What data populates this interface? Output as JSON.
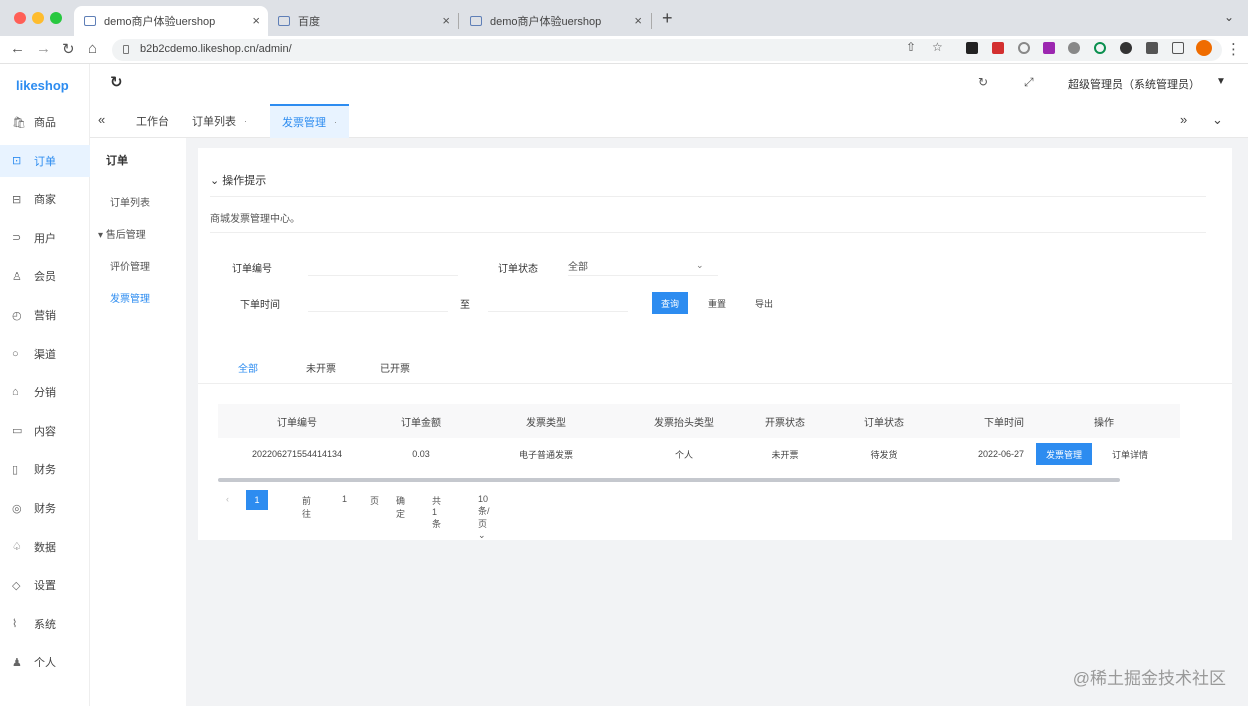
{
  "browser": {
    "tabs": [
      {
        "label": "demo商户体验uershop"
      },
      {
        "label": "百度"
      },
      {
        "label": "demo商户体验uershop"
      }
    ],
    "url": "b2b2cdemo.likeshop.cn/admin/"
  },
  "app": {
    "logo": "likeshop",
    "sidebar": [
      {
        "label": "商品",
        "icon": "🛍"
      },
      {
        "label": "订单",
        "icon": "⊡"
      },
      {
        "label": "商家",
        "icon": "⊟"
      },
      {
        "label": "用户",
        "icon": "⊃"
      },
      {
        "label": "会员",
        "icon": "♙"
      },
      {
        "label": "营销",
        "icon": "◴"
      },
      {
        "label": "渠道",
        "icon": "○"
      },
      {
        "label": "分销",
        "icon": "⌂"
      },
      {
        "label": "内容",
        "icon": "▭"
      },
      {
        "label": "财务",
        "icon": "▯"
      },
      {
        "label": "财务",
        "icon": "◎"
      },
      {
        "label": "数据",
        "icon": "♤"
      },
      {
        "label": "设置",
        "icon": "◇"
      },
      {
        "label": "系统",
        "icon": "⌇"
      },
      {
        "label": "个人",
        "icon": "♟"
      }
    ],
    "submenu": {
      "title": "订单",
      "items": [
        {
          "label": "订单列表"
        },
        {
          "label": "售后管理"
        },
        {
          "label": "评价管理"
        },
        {
          "label": "发票管理"
        }
      ]
    },
    "header": {
      "user": "超级管理员（系统管理员）"
    },
    "page_tabs": [
      {
        "label": "工作台"
      },
      {
        "label": "订单列表"
      },
      {
        "label": "发票管理"
      }
    ],
    "tip": {
      "title": "操作提示",
      "body": "商城发票管理中心。"
    },
    "filters": {
      "order_no_label": "订单编号",
      "order_status_label": "订单状态",
      "order_status_value": "全部",
      "order_time_label": "下单时间",
      "range_sep": "至",
      "buttons": {
        "query": "查询",
        "reset": "重置",
        "export": "导出"
      }
    },
    "filter_tabs": [
      {
        "label": "全部"
      },
      {
        "label": "未开票"
      },
      {
        "label": "已开票"
      }
    ],
    "table": {
      "columns": [
        "订单编号",
        "订单金额",
        "发票类型",
        "发票抬头类型",
        "开票状态",
        "订单状态",
        "下单时间",
        "操作"
      ],
      "rows": [
        {
          "order_no": "202206271554414134",
          "amount": "0.03",
          "invoice_type": "电子普通发票",
          "title_type": "个人",
          "invoice_status": "未开票",
          "order_status": "待发货",
          "time": "2022-06-27",
          "action_primary": "发票管理",
          "action_secondary": "订单详情"
        }
      ]
    },
    "pagination": {
      "prev": "‹",
      "current": "1",
      "goto_label": "前往",
      "goto_value": "1",
      "page_unit": "页",
      "confirm": "确定",
      "total": "共 1 条",
      "page_size": "10 条/页"
    }
  },
  "watermark": "@稀土掘金技术社区"
}
